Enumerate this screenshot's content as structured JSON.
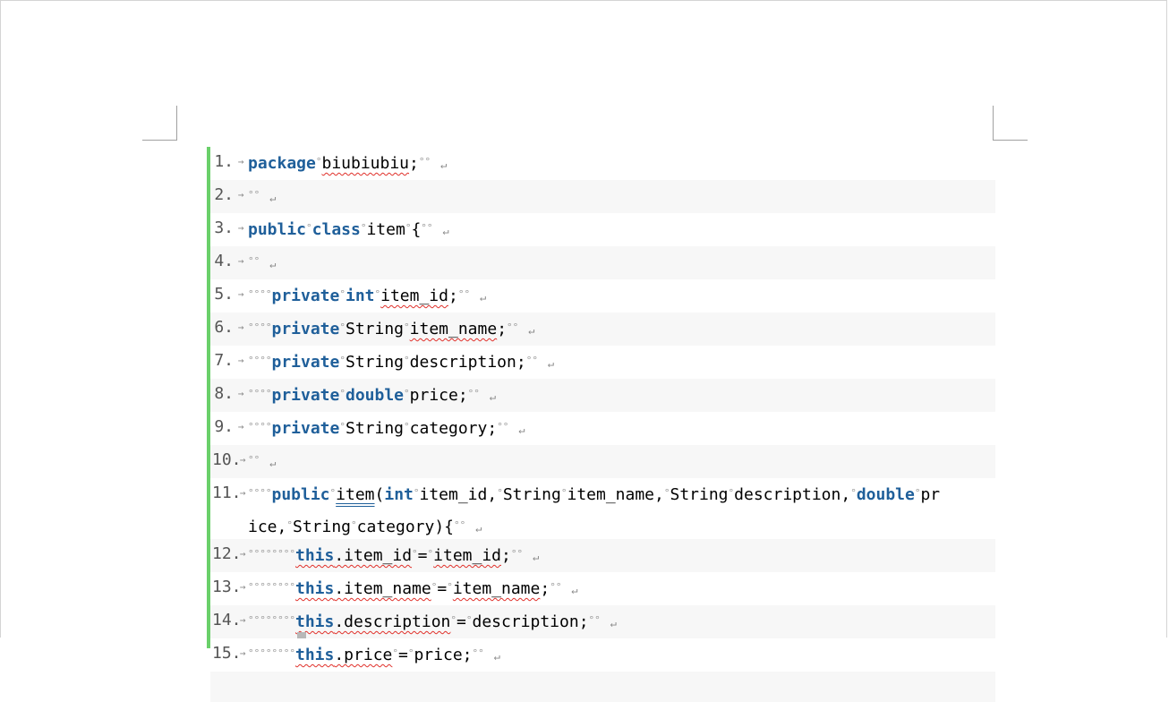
{
  "document": {
    "lines": [
      {
        "num": "1.",
        "t": {
          "kw_package": "package",
          "pkg": "biubiubiu",
          "end": ";"
        }
      },
      {
        "num": "2."
      },
      {
        "num": "3.",
        "t": {
          "kw_public": "public",
          "kw_class": "class",
          "name": "item",
          "brace": "{"
        }
      },
      {
        "num": "4."
      },
      {
        "num": "5.",
        "t": {
          "kw_private": "private",
          "kw_type": "int",
          "field": "item_id",
          "end": ";"
        }
      },
      {
        "num": "6.",
        "t": {
          "kw_private": "private",
          "type": "String",
          "field": "item_name",
          "end": ";"
        }
      },
      {
        "num": "7.",
        "t": {
          "kw_private": "private",
          "type": "String",
          "field": "description",
          "end": ";"
        }
      },
      {
        "num": "8.",
        "t": {
          "kw_private": "private",
          "kw_type": "double",
          "field": "price",
          "end": ";"
        }
      },
      {
        "num": "9.",
        "t": {
          "kw_private": "private",
          "type": "String",
          "field": "category",
          "end": ";"
        }
      },
      {
        "num": "10."
      },
      {
        "num": "11.",
        "t": {
          "kw_public": "public",
          "ctor": "item",
          "paren": "(",
          "kw_int": "int",
          "p1": "item_id,",
          "s1": "String",
          "p2": "item_name,",
          "s2": "String",
          "p3": "description,",
          "kw_double": "double",
          "p4a": "pr",
          "p4b": "ice,",
          "s3": "String",
          "p5": "category){"
        }
      },
      {
        "num": "12.",
        "t": {
          "kw_this": "this",
          "field": ".item_id",
          "eq": "=",
          "val": "item_id",
          "end": ";"
        }
      },
      {
        "num": "13.",
        "t": {
          "kw_this": "this",
          "field": ".item_name",
          "eq": "=",
          "val": "item_name",
          "end": ";"
        }
      },
      {
        "num": "14.",
        "t": {
          "kw_this": "this",
          "field": ".description",
          "eq": "=",
          "val": "description",
          "end": ";"
        }
      },
      {
        "num": "15.",
        "t": {
          "kw_this": "this",
          "field": ".price",
          "eq": "=",
          "val": "price",
          "end": ";"
        }
      }
    ],
    "marks": {
      "tab": "→",
      "space": "°",
      "space2": "°°",
      "space4": "°°°°",
      "space8": "°°°°°°°°",
      "para": "↵"
    }
  }
}
